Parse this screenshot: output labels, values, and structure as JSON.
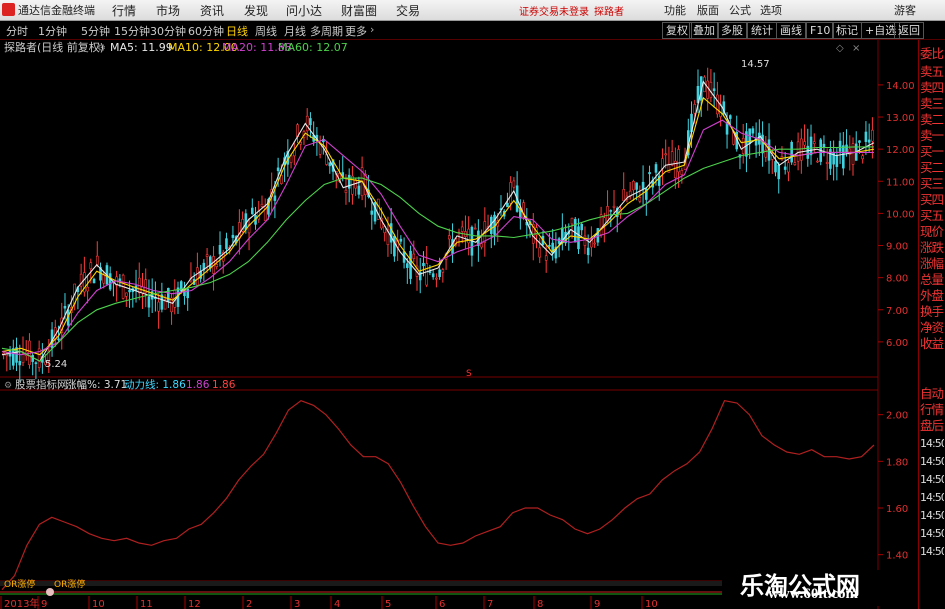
{
  "topbar": {
    "app_title": "通达信金融终端",
    "menus": [
      "行情",
      "市场",
      "资讯",
      "发现",
      "问小达",
      "财富圈",
      "交易"
    ],
    "login_status": "证券交易未登录",
    "user_name": "探路者",
    "right_menus": [
      "功能",
      "版面",
      "公式",
      "选项"
    ],
    "guest": "游客",
    "colors": {
      "bg": "#e6e6e6",
      "login": "#cc0000"
    }
  },
  "subbar": {
    "timeframes": [
      "分时",
      "1分钟",
      "5分钟",
      "15分钟",
      "30分钟",
      "60分钟",
      "日线",
      "周线",
      "月线",
      "多周期",
      "更多"
    ],
    "active": "日线",
    "right_buttons": [
      "复权",
      "叠加",
      "多股",
      "统计",
      "画线",
      "F10",
      "标记",
      "+自选",
      "返回"
    ]
  },
  "main_panel": {
    "stock_label": "探路者(日线 前复权)",
    "ma": [
      {
        "label": "MA5: 11.99",
        "color": "#e8e8e8"
      },
      {
        "label": "MA10: 12.00",
        "color": "#ffd700"
      },
      {
        "label": "MA20: 11.88",
        "color": "#d040d0"
      },
      {
        "label": "MA60: 12.07",
        "color": "#4cd24c"
      }
    ],
    "high_label": "14.57",
    "low_label": "5.24",
    "center_marker": "S",
    "y_ticks": [
      "14.00",
      "13.00",
      "12.00",
      "11.00",
      "10.00",
      "9.00",
      "8.00",
      "7.00",
      "6.00"
    ]
  },
  "sub_panel": {
    "indicator_name": "股票指标网",
    "values": [
      {
        "label": "涨幅%: 3.71",
        "color": "#ddd"
      },
      {
        "label": "动力线: 1.86",
        "color": "#40d8ff"
      },
      {
        "label": "1.86",
        "color": "#d040d0"
      },
      {
        "label": "1.86",
        "color": "#ff4040"
      }
    ],
    "y_ticks": [
      "2.00",
      "1.80",
      "1.60",
      "1.40"
    ]
  },
  "bottom": {
    "flags": [
      "OR涨停",
      "OR涨停"
    ],
    "x_labels": [
      "2013年",
      "9",
      "10",
      "11",
      "12",
      "2",
      "3",
      "4",
      "5",
      "6",
      "7",
      "8",
      "9",
      "10"
    ]
  },
  "sidebar": {
    "items": [
      "委比",
      "卖五",
      "卖四",
      "卖三",
      "卖二",
      "卖一",
      "买一",
      "买二",
      "买三",
      "买四",
      "买五",
      "现价",
      "涨跌",
      "涨幅",
      "总量",
      "外盘",
      "换手",
      "净资",
      "收益",
      "自动",
      "行情",
      "盘后",
      "14:50",
      "14:50",
      "14:50",
      "14:50",
      "14:50",
      "14:50",
      "14:50"
    ]
  },
  "watermark": {
    "title": "乐淘公式网",
    "url": "www.60lt.com"
  },
  "chart_data": {
    "type": "line",
    "candle_count": 270,
    "price_range": [
      5.0,
      14.9
    ],
    "price_high": 14.57,
    "price_low": 5.24,
    "ma_keypoints": {
      "ma5": [
        5.6,
        5.7,
        5.4,
        6.4,
        7.7,
        8.4,
        7.8,
        7.6,
        7.4,
        7.2,
        8.0,
        8.4,
        8.9,
        9.8,
        10.3,
        11.8,
        12.8,
        12.0,
        10.8,
        11.0,
        9.8,
        8.8,
        8.1,
        8.3,
        9.3,
        9.1,
        9.8,
        10.7,
        9.3,
        8.7,
        9.5,
        9.1,
        9.8,
        10.5,
        10.8,
        11.5,
        11.6,
        14.1,
        13.3,
        12.0,
        12.4,
        11.5,
        11.9,
        12.0,
        11.8,
        11.9,
        12.2
      ],
      "ma10": [
        5.7,
        5.8,
        5.6,
        6.2,
        7.4,
        8.2,
        7.9,
        7.7,
        7.5,
        7.3,
        7.8,
        8.3,
        8.8,
        9.6,
        10.2,
        11.6,
        12.5,
        12.1,
        11.1,
        11.0,
        10.1,
        9.0,
        8.2,
        8.4,
        9.1,
        9.2,
        9.6,
        10.4,
        9.6,
        8.8,
        9.3,
        9.2,
        9.7,
        10.3,
        10.7,
        11.3,
        11.5,
        13.6,
        13.1,
        12.2,
        12.3,
        11.7,
        11.8,
        11.9,
        11.9,
        11.9,
        12.0
      ],
      "ma20": [
        5.7,
        5.6,
        5.7,
        6.0,
        6.9,
        7.6,
        7.9,
        7.8,
        7.6,
        7.5,
        7.6,
        8.0,
        8.5,
        9.2,
        9.8,
        10.9,
        12.1,
        12.3,
        11.8,
        11.3,
        10.6,
        9.6,
        8.7,
        8.5,
        8.8,
        9.0,
        9.3,
        9.9,
        9.8,
        9.2,
        9.1,
        9.2,
        9.4,
        9.9,
        10.3,
        10.9,
        11.2,
        12.6,
        12.9,
        12.5,
        12.3,
        11.9,
        11.8,
        11.9,
        11.9,
        11.9,
        11.9
      ],
      "ma60": [
        5.8,
        5.7,
        5.4,
        6.0,
        6.6,
        7.0,
        7.2,
        7.35,
        7.5,
        7.6,
        7.7,
        7.85,
        8.1,
        8.5,
        9.1,
        9.8,
        10.4,
        10.9,
        11.1,
        11.1,
        10.9,
        10.5,
        10.0,
        9.6,
        9.4,
        9.3,
        9.3,
        9.25,
        9.35,
        9.45,
        9.6,
        9.8,
        9.95,
        10.0,
        10.3,
        10.7,
        11.1,
        11.4,
        11.6,
        11.8,
        11.9,
        12.0,
        12.0,
        12.05,
        12.05,
        12.07,
        12.07
      ]
    },
    "indicator_range": [
      1.3,
      2.08
    ],
    "indicator_line": [
      1.25,
      1.31,
      1.44,
      1.53,
      1.56,
      1.54,
      1.52,
      1.49,
      1.47,
      1.46,
      1.47,
      1.45,
      1.44,
      1.46,
      1.47,
      1.51,
      1.53,
      1.58,
      1.64,
      1.72,
      1.78,
      1.83,
      1.92,
      2.02,
      2.06,
      2.04,
      2.0,
      1.94,
      1.87,
      1.82,
      1.82,
      1.79,
      1.71,
      1.61,
      1.52,
      1.45,
      1.44,
      1.45,
      1.48,
      1.5,
      1.52,
      1.58,
      1.6,
      1.6,
      1.57,
      1.55,
      1.51,
      1.49,
      1.51,
      1.55,
      1.6,
      1.64,
      1.66,
      1.72,
      1.76,
      1.79,
      1.84,
      1.94,
      2.06,
      2.05,
      2.0,
      1.91,
      1.87,
      1.84,
      1.83,
      1.85,
      1.82,
      1.82,
      1.81,
      1.82,
      1.87
    ]
  }
}
